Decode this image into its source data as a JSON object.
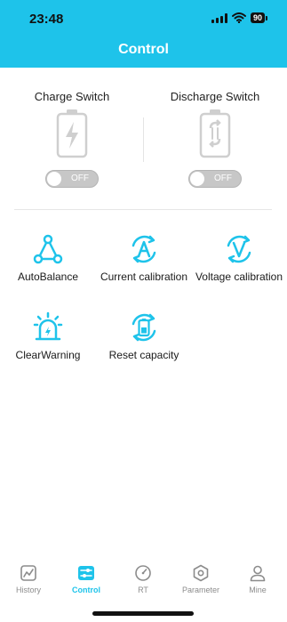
{
  "status_bar": {
    "time": "23:48",
    "battery_level": "90"
  },
  "header": {
    "title": "Control"
  },
  "switches": [
    {
      "label": "Charge Switch",
      "state": "OFF"
    },
    {
      "label": "Discharge Switch",
      "state": "OFF"
    }
  ],
  "actions": [
    {
      "label": "AutoBalance"
    },
    {
      "label": "Current calibration"
    },
    {
      "label": "Voltage calibration"
    },
    {
      "label": "ClearWarning"
    },
    {
      "label": "Reset capacity"
    }
  ],
  "tabbar": {
    "active": "Control",
    "tabs": [
      {
        "label": "History",
        "icon": "chart-icon"
      },
      {
        "label": "Control",
        "icon": "sliders-icon"
      },
      {
        "label": "RT",
        "icon": "gauge-icon"
      },
      {
        "label": "Parameter",
        "icon": "hexagon-gear-icon"
      },
      {
        "label": "Mine",
        "icon": "person-icon"
      }
    ]
  },
  "colors": {
    "accent": "#1ec3ea",
    "toggle_off": "#c7c7c7",
    "inactive": "#8c8c8c"
  }
}
